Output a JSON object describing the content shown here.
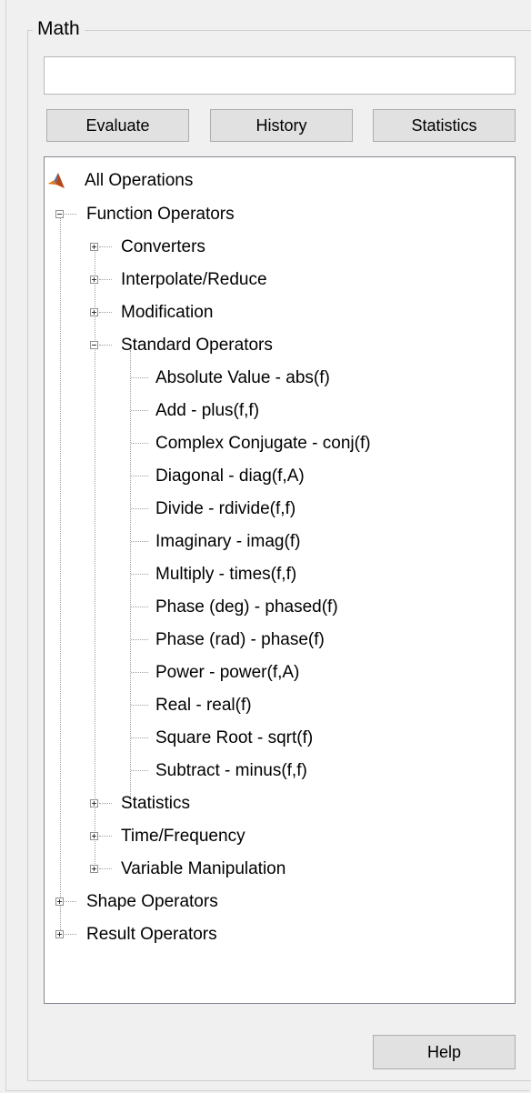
{
  "panel": {
    "title": "Math"
  },
  "expression": {
    "value": "",
    "placeholder": ""
  },
  "buttons": {
    "evaluate": "Evaluate",
    "history": "History",
    "statistics": "Statistics",
    "help": "Help"
  },
  "tree": {
    "root": "All Operations",
    "function_operators": "Function Operators",
    "converters": "Converters",
    "interpolate": "Interpolate/Reduce",
    "modification": "Modification",
    "standard_operators": "Standard Operators",
    "standard_items": [
      "Absolute Value - abs(f)",
      "Add - plus(f,f)",
      "Complex Conjugate - conj(f)",
      "Diagonal - diag(f,A)",
      "Divide - rdivide(f,f)",
      "Imaginary - imag(f)",
      "Multiply - times(f,f)",
      "Phase (deg) - phased(f)",
      "Phase (rad) - phase(f)",
      "Power - power(f,A)",
      "Real - real(f)",
      "Square Root - sqrt(f)",
      "Subtract - minus(f,f)"
    ],
    "statistics": "Statistics",
    "time_frequency": "Time/Frequency",
    "variable_manipulation": "Variable Manipulation",
    "shape_operators": "Shape Operators",
    "result_operators": "Result Operators"
  },
  "icons": {
    "root": "matlab-membrane-icon"
  },
  "colors": {
    "background": "#f0f0f0",
    "tree_bg": "#ffffff",
    "button_bg": "#e1e1e1"
  }
}
